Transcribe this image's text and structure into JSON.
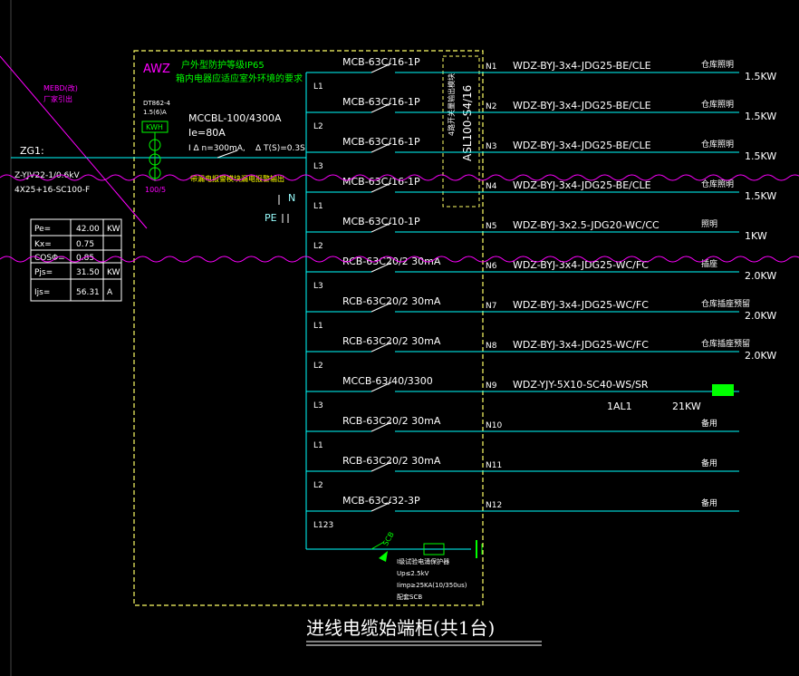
{
  "panel": {
    "code": "AWZ",
    "note_line1": "户外型防护等级IP65",
    "note_line2": "箱内电器应适应室外环境的要求",
    "main_breaker": "MCCBL-100/4300A",
    "rated_current": "Ie=80A",
    "leak_current": "I Δ n=300mA,",
    "trip_time": "Δ T(S)=0.3S",
    "meter_model": "DT862-4",
    "meter_rating": "1.5(6)A",
    "meter_label": "KWH",
    "ct_label": "100/5",
    "green_note": "带漏电报警模块漏电报警输出",
    "n_label": "N",
    "pe_label": "PE",
    "pole_label": "L1 L2 L3"
  },
  "incoming": {
    "zg": "ZG1:",
    "cable_line1": "Z-YJV22-1/0.6kV",
    "cable_line2": "4X25+16-SC100-F",
    "mebd_line1": "MEBD(改)",
    "mebd_line2": "厂家引出"
  },
  "load_table": [
    {
      "k": "Pe=",
      "v": "42.00",
      "u": "KW"
    },
    {
      "k": "Kx=",
      "v": "0.75",
      "u": ""
    },
    {
      "k": "COSΦ=",
      "v": "0.85",
      "u": ""
    },
    {
      "k": "Pjs=",
      "v": "31.50",
      "u": "KW"
    },
    {
      "k": "Ijs=",
      "v": "56.31",
      "u": "A"
    }
  ],
  "spd_box": {
    "line1": "ASL100-S4/16",
    "line2": "4路开关量输出模块"
  },
  "circuits": [
    {
      "breaker": "MCB-63C/16-1P",
      "phase": "L1",
      "no": "N1",
      "cable": "WDZ-BYJ-3x4-JDG25-BE/CLE",
      "use": "仓库照明",
      "power": "1.5KW"
    },
    {
      "breaker": "MCB-63C/16-1P",
      "phase": "L2",
      "no": "N2",
      "cable": "WDZ-BYJ-3x4-JDG25-BE/CLE",
      "use": "仓库照明",
      "power": "1.5KW"
    },
    {
      "breaker": "MCB-63C/16-1P",
      "phase": "L3",
      "no": "N3",
      "cable": "WDZ-BYJ-3x4-JDG25-BE/CLE",
      "use": "仓库照明",
      "power": "1.5KW"
    },
    {
      "breaker": "MCB-63C/16-1P",
      "phase": "L1",
      "no": "N4",
      "cable": "WDZ-BYJ-3x4-JDG25-BE/CLE",
      "use": "仓库照明",
      "power": "1.5KW"
    },
    {
      "breaker": "MCB-63C/10-1P",
      "phase": "L2",
      "no": "N5",
      "cable": "WDZ-BYJ-3x2.5-JDG20-WC/CC",
      "use": "照明",
      "power": "1KW"
    },
    {
      "breaker": "RCB-63C20/2 30mA",
      "phase": "L3",
      "no": "N6",
      "cable": "WDZ-BYJ-3x4-JDG25-WC/FC",
      "use": "插座",
      "power": "2.0KW"
    },
    {
      "breaker": "RCB-63C20/2 30mA",
      "phase": "L1",
      "no": "N7",
      "cable": "WDZ-BYJ-3x4-JDG25-WC/FC",
      "use": "仓库插座预留",
      "power": "2.0KW"
    },
    {
      "breaker": "RCB-63C20/2 30mA",
      "phase": "L2",
      "no": "N8",
      "cable": "WDZ-BYJ-3x4-JDG25-WC/FC",
      "use": "仓库插座预留",
      "power": "2.0KW"
    },
    {
      "breaker": "MCCB-63/40/3300",
      "phase": "L3",
      "no": "N9",
      "cable": "WDZ-YJY-5X10-SC40-WS/SR",
      "use": "",
      "power": "",
      "sub": "1AL1",
      "sub_power": "21KW"
    },
    {
      "breaker": "RCB-63C20/2 30mA",
      "phase": "L1",
      "no": "N10",
      "cable": "",
      "use": "备用",
      "power": ""
    },
    {
      "breaker": "RCB-63C20/2 30mA",
      "phase": "L2",
      "no": "N11",
      "cable": "",
      "use": "备用",
      "power": ""
    },
    {
      "breaker": "MCB-63C/32-3P",
      "phase": "L123",
      "no": "N12",
      "cable": "",
      "use": "备用",
      "power": ""
    }
  ],
  "surge": {
    "scb": "SCB",
    "line1": "I级试验电涌保护器",
    "line2": "Up≤2.5kV",
    "line3": "Iimp≥25KA(10/350us)",
    "line4": "配套SCB"
  },
  "caption": "进线电缆始端柜(共1台)",
  "colors": {
    "frame": "#ffff66",
    "busbar": "#00ffff",
    "wave": "#ff00ff",
    "accent": "#00ff00"
  }
}
